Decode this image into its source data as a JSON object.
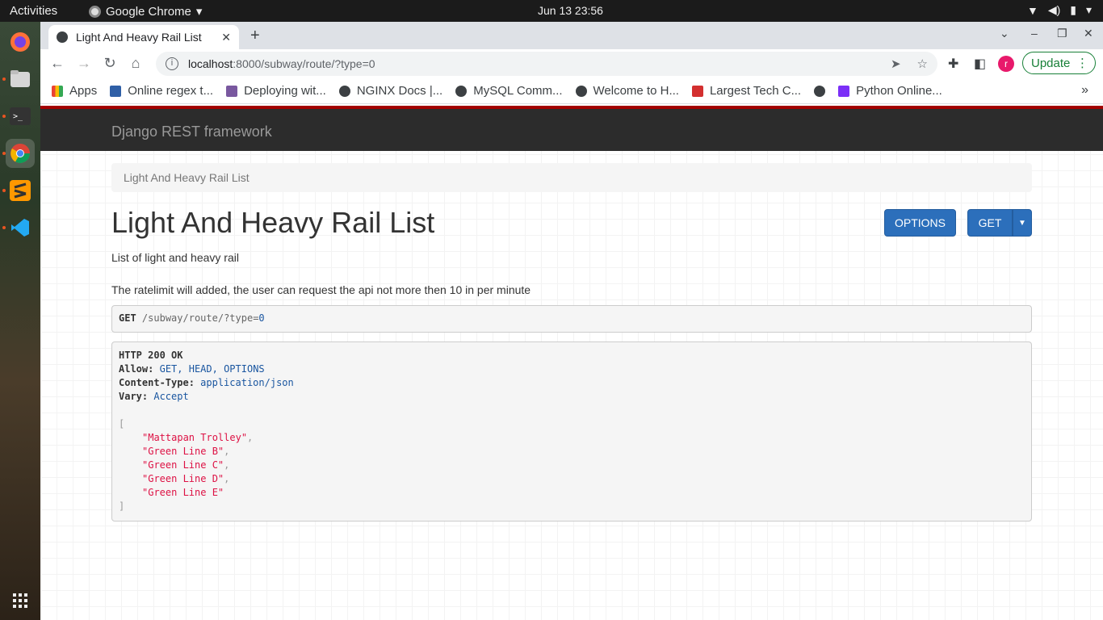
{
  "topbar": {
    "activities": "Activities",
    "app_name": "Google Chrome",
    "clock": "Jun 13  23:56"
  },
  "dock": [
    "firefox-icon",
    "files-icon",
    "terminal-icon",
    "chrome-icon",
    "sublime-icon",
    "vscode-icon",
    "app-grid-icon"
  ],
  "browser": {
    "tab_title": "Light And Heavy Rail List",
    "url_host": "localhost",
    "url_rest": ":8000/subway/route/?type=0",
    "update_label": "Update",
    "avatar_letter": "r",
    "bookmarks": [
      {
        "label": "Apps"
      },
      {
        "label": "Online regex t..."
      },
      {
        "label": "Deploying wit..."
      },
      {
        "label": "NGINX Docs |..."
      },
      {
        "label": "MySQL Comm..."
      },
      {
        "label": "Welcome to H..."
      },
      {
        "label": "Largest Tech C..."
      },
      {
        "label": ""
      },
      {
        "label": "Python Online..."
      }
    ]
  },
  "drf": {
    "brand": "Django REST framework",
    "breadcrumb": "Light And Heavy Rail List",
    "title": "Light And Heavy Rail List",
    "options_label": "OPTIONS",
    "get_label": "GET",
    "description": "List of light and heavy rail",
    "ratelimit_note": "The ratelimit will added, the user can request the api not more then 10 in per minute",
    "request": {
      "method": "GET",
      "path": "/subway/route/?type=",
      "type_value": "0"
    },
    "response": {
      "status": "HTTP 200 OK",
      "headers": [
        {
          "name": "Allow:",
          "value": "GET, HEAD, OPTIONS"
        },
        {
          "name": "Content-Type:",
          "value": "application/json"
        },
        {
          "name": "Vary:",
          "value": "Accept"
        }
      ],
      "open_bracket": "[",
      "close_bracket": "]",
      "items": [
        "\"Mattapan Trolley\"",
        "\"Green Line B\"",
        "\"Green Line C\"",
        "\"Green Line D\"",
        "\"Green Line E\""
      ]
    }
  },
  "colors": {
    "drf_red": "#a30000",
    "drf_nav": "#2c2c2c",
    "btn_blue": "#2c6fbb",
    "string_red": "#d14"
  }
}
